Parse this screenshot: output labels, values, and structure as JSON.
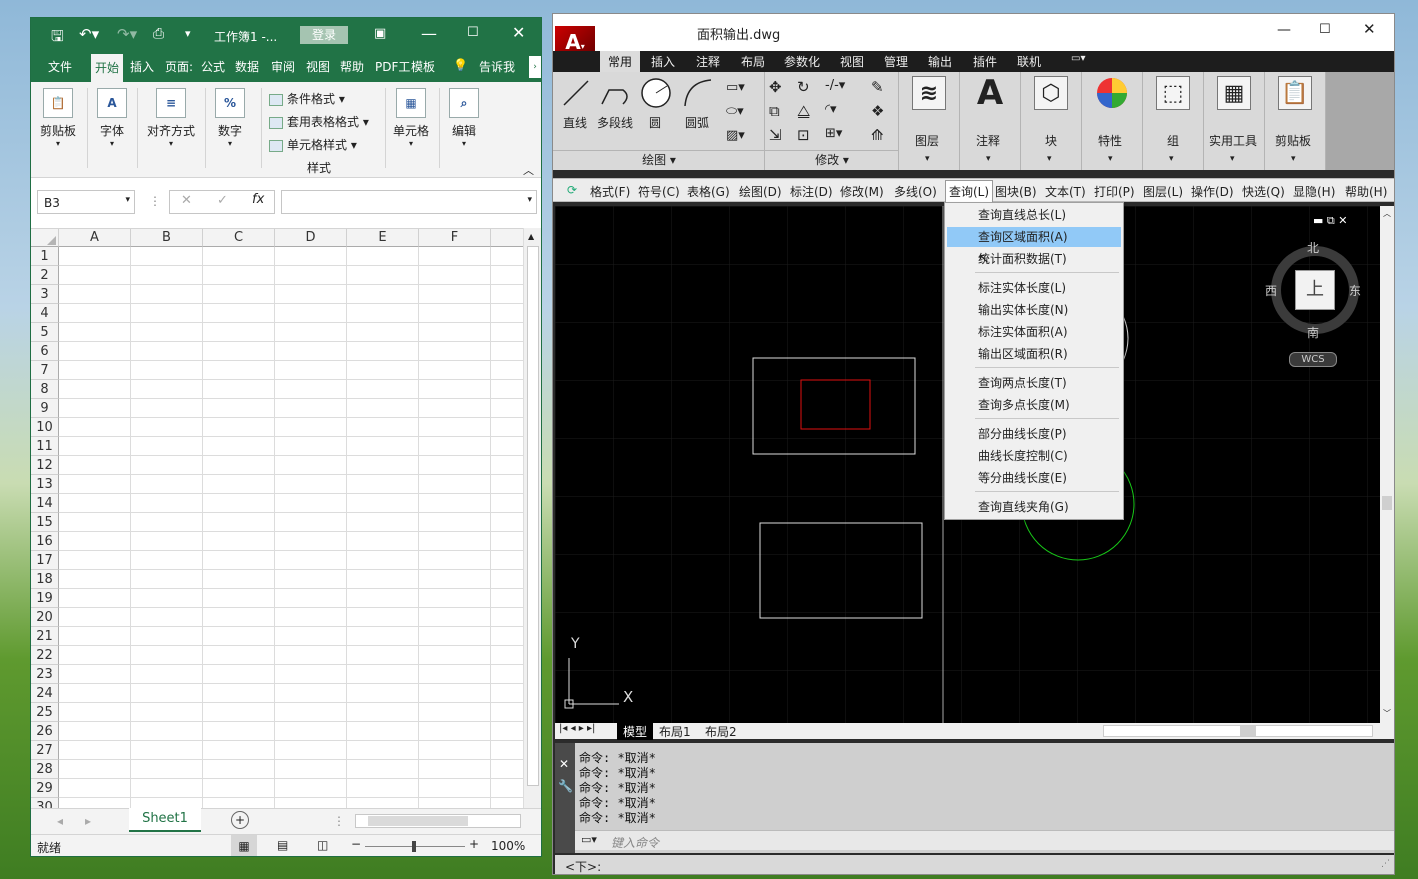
{
  "excel": {
    "qat": {
      "save_icon": "save-icon",
      "undo_icon": "undo-icon",
      "redo_icon": "redo-icon",
      "preview_icon": "print-preview-icon",
      "customize": "▾"
    },
    "title": "工作簿1 -...",
    "login": "登录",
    "window_controls": [
      "ribbon-display-icon",
      "minimize-icon",
      "maximize-icon",
      "close-icon"
    ],
    "tabs": [
      "文件",
      "开始",
      "插入",
      "页面:",
      "公式",
      "数据",
      "审阅",
      "视图",
      "帮助",
      "PDF工",
      "模板",
      "告诉我"
    ],
    "tellme_icon": "lightbulb-icon",
    "ribbon": {
      "paste": "剪贴板",
      "font": "字体",
      "align": "对齐方式",
      "number": "数字",
      "conditional": "条件格式",
      "table_format": "套用表格格式",
      "cell_style": "单元格样式",
      "styles_group": "样式",
      "cells": "单元格",
      "edit": "编辑"
    },
    "namebox": "B3",
    "formula_icons": {
      "cancel": "✕",
      "enter": "✓",
      "fx": "fx"
    },
    "columns": [
      "A",
      "B",
      "C",
      "D",
      "E",
      "F"
    ],
    "rows": [
      "1",
      "2",
      "3",
      "4",
      "5",
      "6",
      "7",
      "8",
      "9",
      "10",
      "11",
      "12",
      "13",
      "14",
      "15",
      "16",
      "17",
      "18",
      "19",
      "20",
      "21",
      "22",
      "23",
      "24",
      "25",
      "26",
      "27",
      "28",
      "29",
      "30"
    ],
    "sheet_tab": "Sheet1",
    "status": "就绪",
    "zoom": "100%"
  },
  "cad": {
    "title": "面积输出.dwg",
    "tabs": [
      "常用",
      "插入",
      "注释",
      "布局",
      "参数化",
      "视图",
      "管理",
      "输出",
      "插件",
      "联机"
    ],
    "ribbon": {
      "draw_items": [
        "直线",
        "多段线",
        "圆",
        "圆弧"
      ],
      "draw_group": "绘图",
      "modify_group": "修改",
      "big": [
        "图层",
        "注释",
        "块",
        "特性",
        "组",
        "实用工具",
        "剪贴板"
      ]
    },
    "menubar": [
      "格式(F)",
      "符号(C)",
      "表格(G)",
      "绘图(D)",
      "标注(D)",
      "修改(M)",
      "多线(O)",
      "查询(L)",
      "图块(B)",
      "文本(T)",
      "打印(P)",
      "图层(L)",
      "操作(D)",
      "快选(Q)",
      "显隐(H)",
      "帮助(H)"
    ],
    "dropdown": [
      "查询直线总长(L)",
      "查询区域面积(A)",
      "统计面积数据(T)",
      "标注实体长度(L)",
      "输出实体长度(N)",
      "标注实体面积(A)",
      "输出区域面积(R)",
      "查询两点长度(T)",
      "查询多点长度(M)",
      "部分曲线长度(P)",
      "曲线长度控制(C)",
      "等分曲线长度(E)",
      "查询直线夹角(G)"
    ],
    "viewcube": {
      "n": "北",
      "s": "南",
      "e": "东",
      "w": "西",
      "top": "上",
      "wcs": "WCS"
    },
    "axis": {
      "y": "Y",
      "x": "X"
    },
    "layouts": [
      "模型",
      "布局1",
      "布局2"
    ],
    "cmd_lines": [
      "命令: *取消*",
      "命令: *取消*",
      "命令: *取消*",
      "命令: *取消*",
      "命令: *取消*"
    ],
    "cmd_placeholder": "键入命令",
    "status": "<下>:"
  }
}
